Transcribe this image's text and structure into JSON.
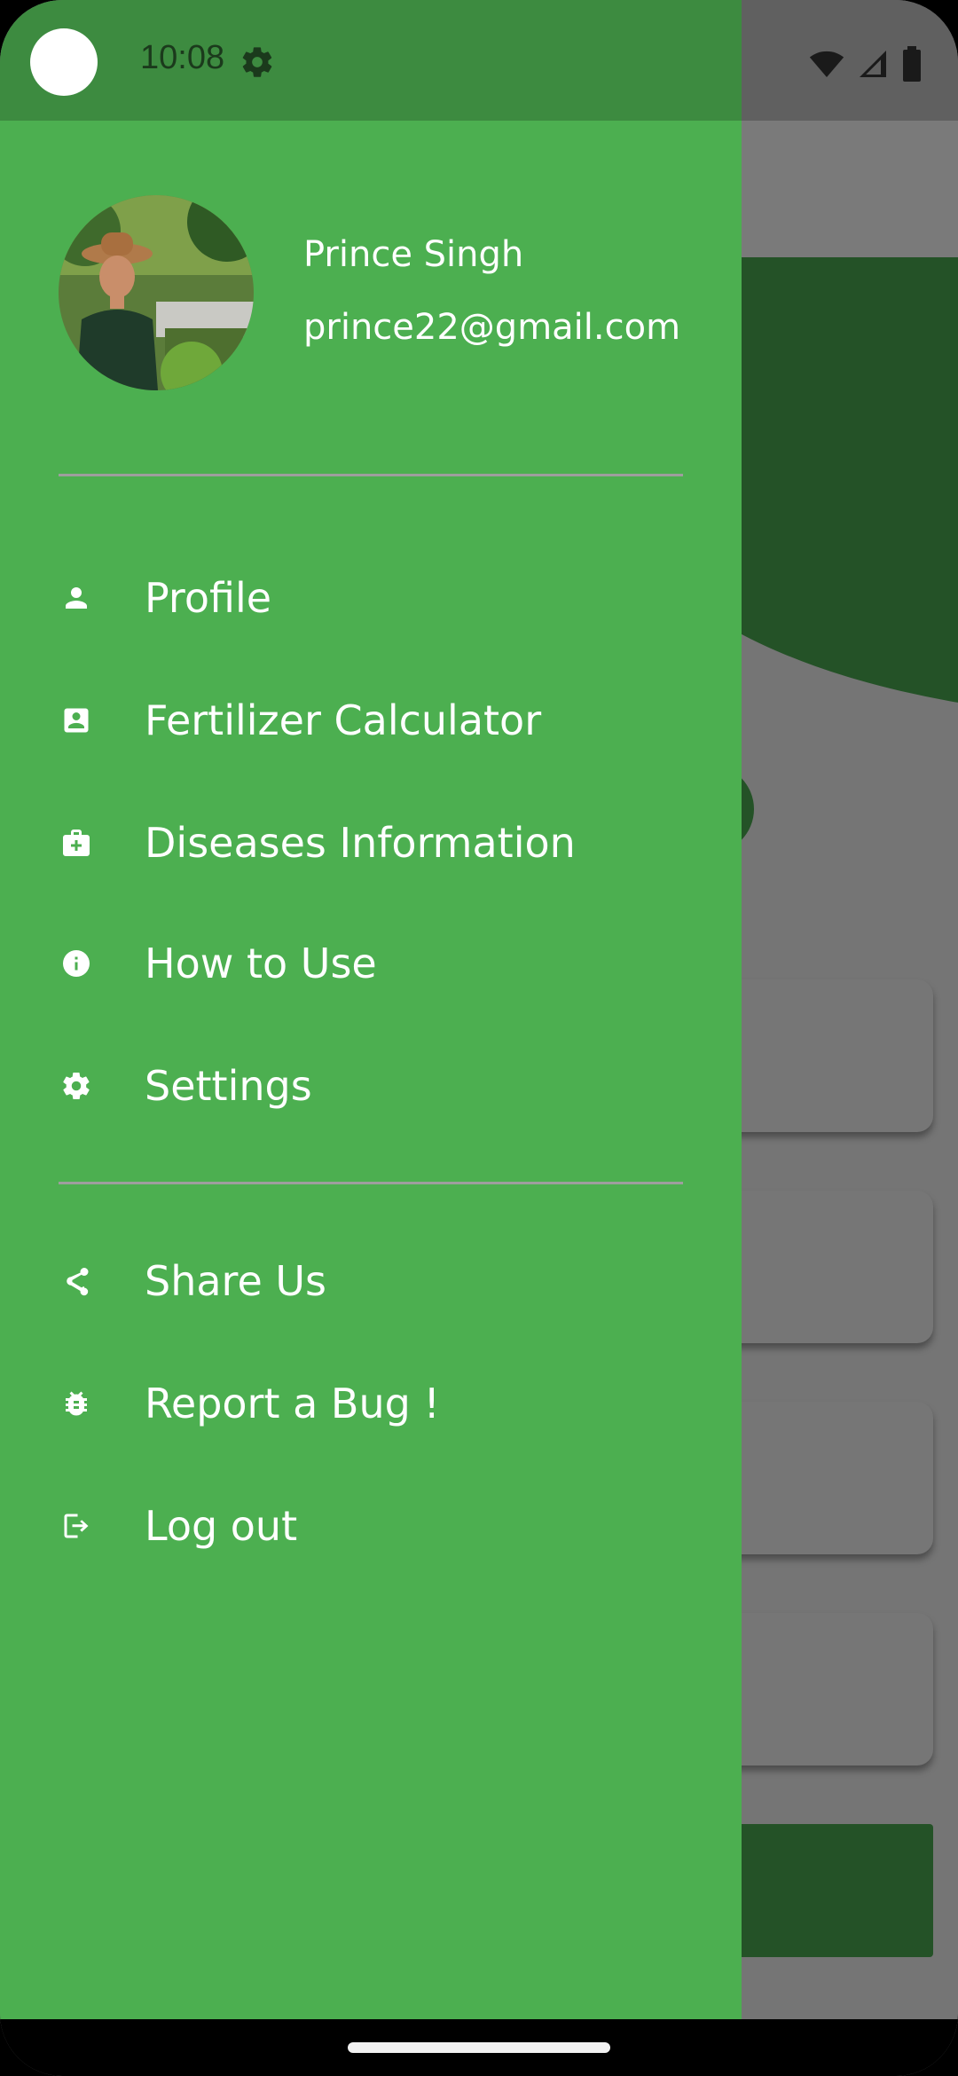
{
  "status_bar": {
    "time": "10:08"
  },
  "drawer": {
    "user": {
      "name": "Prince Singh",
      "email": "prince22@gmail.com"
    },
    "menu_main": [
      {
        "label": "Profile",
        "icon": "person-icon"
      },
      {
        "label": "Fertilizer Calculator",
        "icon": "contact-card-icon"
      },
      {
        "label": "Diseases Information",
        "icon": "medical-kit-icon"
      },
      {
        "label": "How to Use",
        "icon": "info-icon"
      },
      {
        "label": "Settings",
        "icon": "gear-icon"
      }
    ],
    "menu_secondary": [
      {
        "label": "Share Us",
        "icon": "share-icon"
      },
      {
        "label": "Report a Bug !",
        "icon": "bug-icon"
      },
      {
        "label": "Log out",
        "icon": "logout-icon"
      }
    ]
  },
  "colors": {
    "drawer_bg": "#4caf50",
    "status_bar": "#3d8b40",
    "dark_green": "#245227"
  }
}
